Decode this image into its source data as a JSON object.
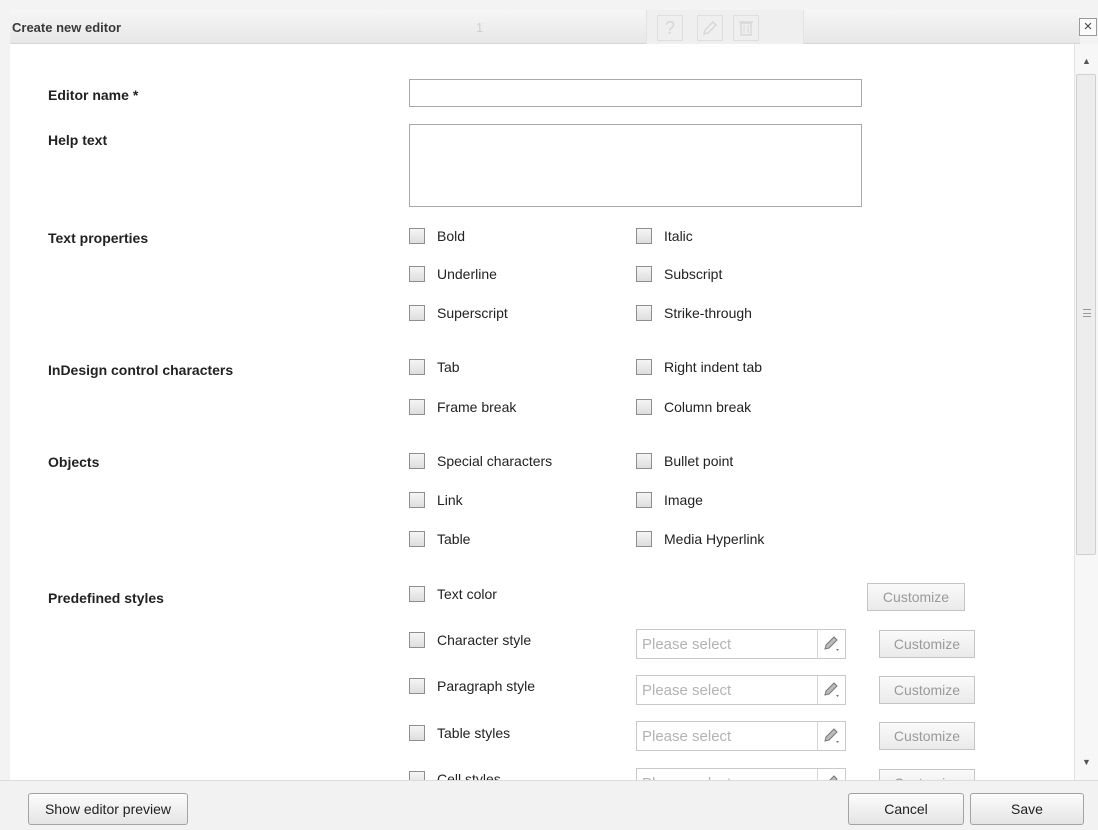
{
  "dialog": {
    "title": "Create new editor",
    "ghost_number": "1",
    "close_glyph": "×"
  },
  "form": {
    "editor_name_label": "Editor name",
    "required_marker": "*",
    "editor_name_value": "",
    "help_text_label": "Help text",
    "help_text_value": ""
  },
  "sections": {
    "text_properties": {
      "label": "Text properties",
      "options": [
        "Bold",
        "Italic",
        "Underline",
        "Subscript",
        "Superscript",
        "Strike-through"
      ]
    },
    "control_characters": {
      "label": "InDesign control characters",
      "options": [
        "Tab",
        "Right indent tab",
        "Frame break",
        "Column break"
      ]
    },
    "objects": {
      "label": "Objects",
      "options": [
        "Special characters",
        "Bullet point",
        "Link",
        "Image",
        "Table",
        "Media Hyperlink"
      ]
    },
    "predefined_styles": {
      "label": "Predefined styles",
      "text_color": "Text color",
      "character_style": "Character style",
      "paragraph_style": "Paragraph style",
      "table_styles": "Table styles",
      "cell_styles": "Cell styles",
      "select_placeholder": "Please select",
      "customize_label": "Customize"
    }
  },
  "footer": {
    "preview_button": "Show editor preview",
    "cancel_button": "Cancel",
    "save_button": "Save"
  },
  "icons": {
    "help": "help-icon",
    "edit": "edit-icon",
    "delete": "trash-icon",
    "close": "close-icon",
    "style_picker": "brush-picker-icon"
  },
  "colors": {
    "title_bar": "#eeeeee",
    "content_bg": "#ffffff",
    "placeholder": "#b3b3b3",
    "disabled_text": "#9a9a9a"
  }
}
